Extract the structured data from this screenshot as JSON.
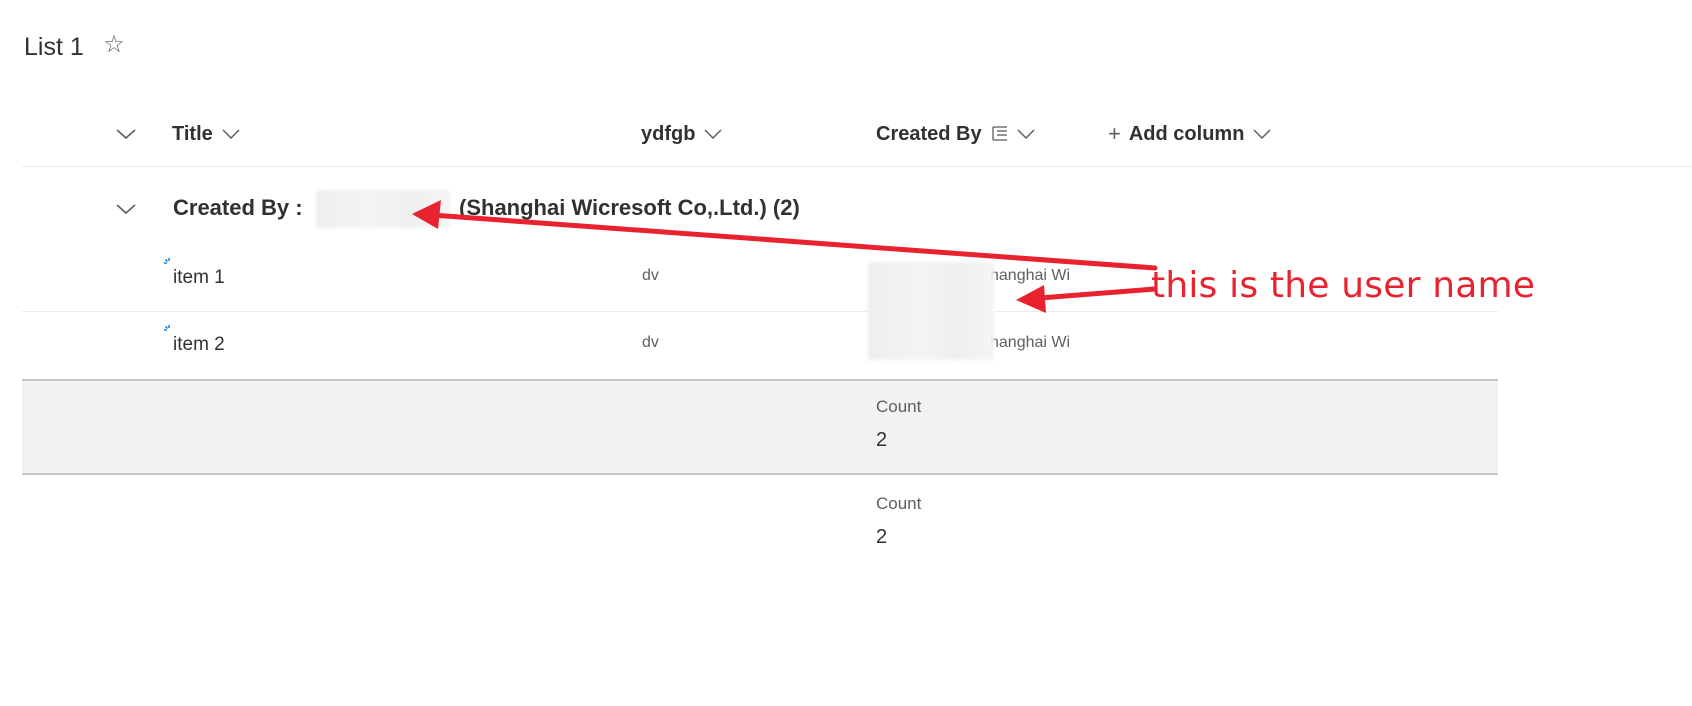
{
  "list": {
    "title": "List 1",
    "favorite_icon": "☆"
  },
  "columns": {
    "title": "Title",
    "ydfgb": "ydfgb",
    "created_by": "Created By",
    "add_column": "Add column",
    "add_icon": "+"
  },
  "group": {
    "label": "Created By :",
    "suffix": "(Shanghai Wicresoft Co,.Ltd.) (2)"
  },
  "rows": [
    {
      "title": "item 1",
      "ydfgb": "dv",
      "created_by_visible": "hanghai Wi"
    },
    {
      "title": "item 2",
      "ydfgb": "dv",
      "created_by_visible": "hanghai Wi"
    }
  ],
  "group_footer": {
    "count_label": "Count",
    "count_value": "2"
  },
  "total_footer": {
    "count_label": "Count",
    "count_value": "2"
  },
  "annotation": {
    "text": "this is the user name",
    "color": "#e8232f"
  },
  "colors": {
    "text": "#323130",
    "secondary_text": "#605e5c",
    "footer_bg": "#f3f2f1",
    "new_item_icon": "#0078d4"
  }
}
